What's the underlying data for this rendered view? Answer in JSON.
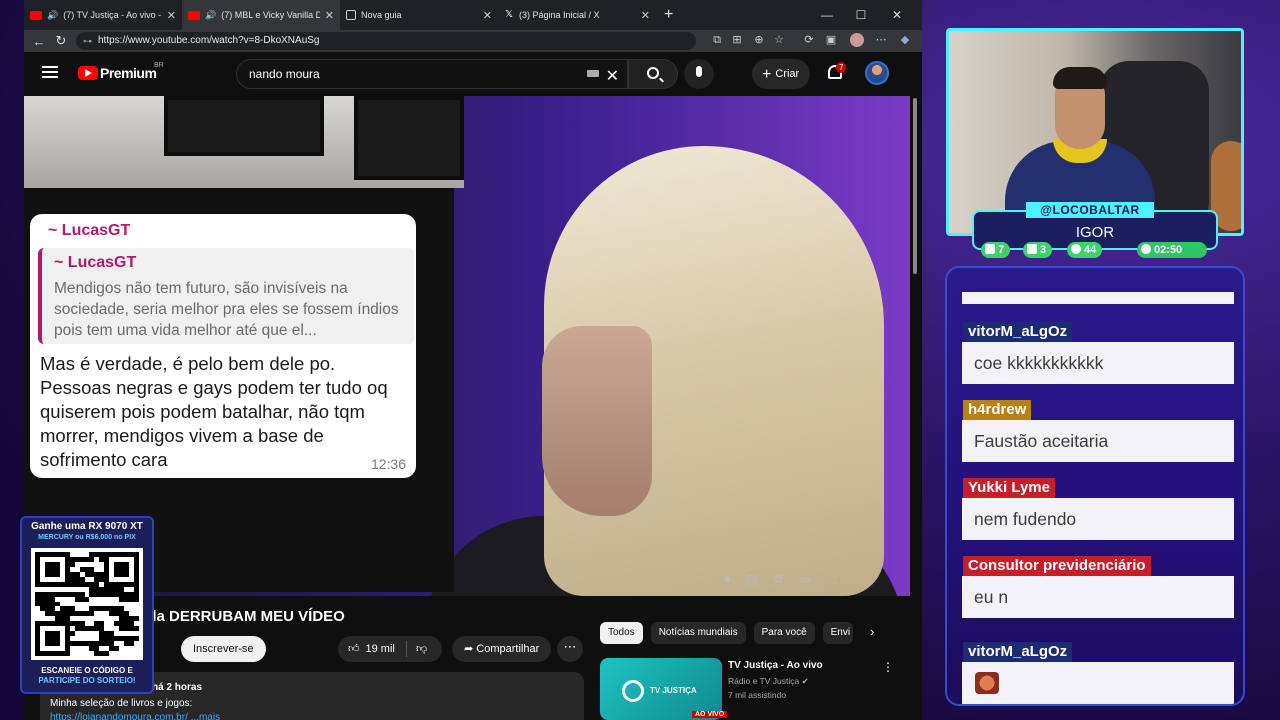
{
  "browser": {
    "tabs": [
      {
        "title": "(7) TV Justiça - Ao vivo - YouT",
        "icon": "youtube-icon",
        "audio": true,
        "active": false
      },
      {
        "title": "(7) MBL e Vicky Vanilla DERRU",
        "icon": "youtube-icon",
        "audio": true,
        "active": true
      },
      {
        "title": "Nova guia",
        "icon": "page-icon",
        "audio": false,
        "active": false
      },
      {
        "title": "(3) Página Inicial / X",
        "icon": "x-icon",
        "audio": false,
        "active": false
      }
    ],
    "url": "https://www.youtube.com/watch?v=8-DkoXNAuSg"
  },
  "youtube": {
    "brand": "Premium",
    "region": "BR",
    "search_value": "nando moura",
    "create_label": "Criar",
    "notification_count": "7",
    "video_title": "illa DERRUBAM MEU VÍDEO",
    "subscribe_label": "Inscrever-se",
    "likes": "19 mil",
    "share_label": "Compartilhar",
    "description": {
      "meta": "há 2 horas",
      "line": "Minha seleção de livros e jogos:",
      "link": "https://lojanandomoura.com.br/ ...mais"
    },
    "chips": [
      "Todos",
      "Notícias mundiais",
      "Para você",
      "Envi"
    ],
    "recommendation": {
      "title": "TV Justiça - Ao vivo",
      "channel": "Rádio e TV Justiça",
      "views": "7 mil assistindo",
      "logo_text": "TV JUSTIÇA",
      "live_badge": "AO VIVO"
    }
  },
  "video_content": {
    "bubble_sender": "~ LucasGT",
    "quote_sender": "~ LucasGT",
    "quote_text": "Mendigos não tem futuro, são invisíveis na sociedade, seria melhor pra eles se fossem índios pois tem uma vida melhor até que el...",
    "message": "Mas é verdade, é pelo bem dele po. Pessoas negras e gays podem ter tudo oq quiserem pois podem batalhar, não tqm morrer, mendigos vivem a base de sofrimento cara",
    "time": "12:36"
  },
  "giveaway": {
    "title": "Ganhe uma RX 9070 XT",
    "subtitle": "MERCURY ou R$6.000 no PIX",
    "cta_line1": "ESCANEIE O CÓDIGO E",
    "cta_line2": "PARTICIPE DO SORTEIO!"
  },
  "stream": {
    "handle": "@LOCOBALTAR",
    "name": "IGOR",
    "stats": {
      "chat": "7",
      "video": "3",
      "users": "44",
      "clock": "02:50"
    },
    "accent_color": "#4ff0ff"
  },
  "chat": [
    {
      "user": "vitorM_aLgOz",
      "message": "coe kkkkkkkkkkk",
      "color": "blue"
    },
    {
      "user": "h4rdrew",
      "message": "Faustão aceitaria",
      "color": "gold"
    },
    {
      "user": "Yukki Lyme",
      "message": "nem fudendo",
      "color": "red"
    },
    {
      "user": "Consultor previdenciário",
      "message": "eu n",
      "color": "red"
    },
    {
      "user": "vitorM_aLgOz",
      "message": "",
      "color": "blue"
    }
  ]
}
